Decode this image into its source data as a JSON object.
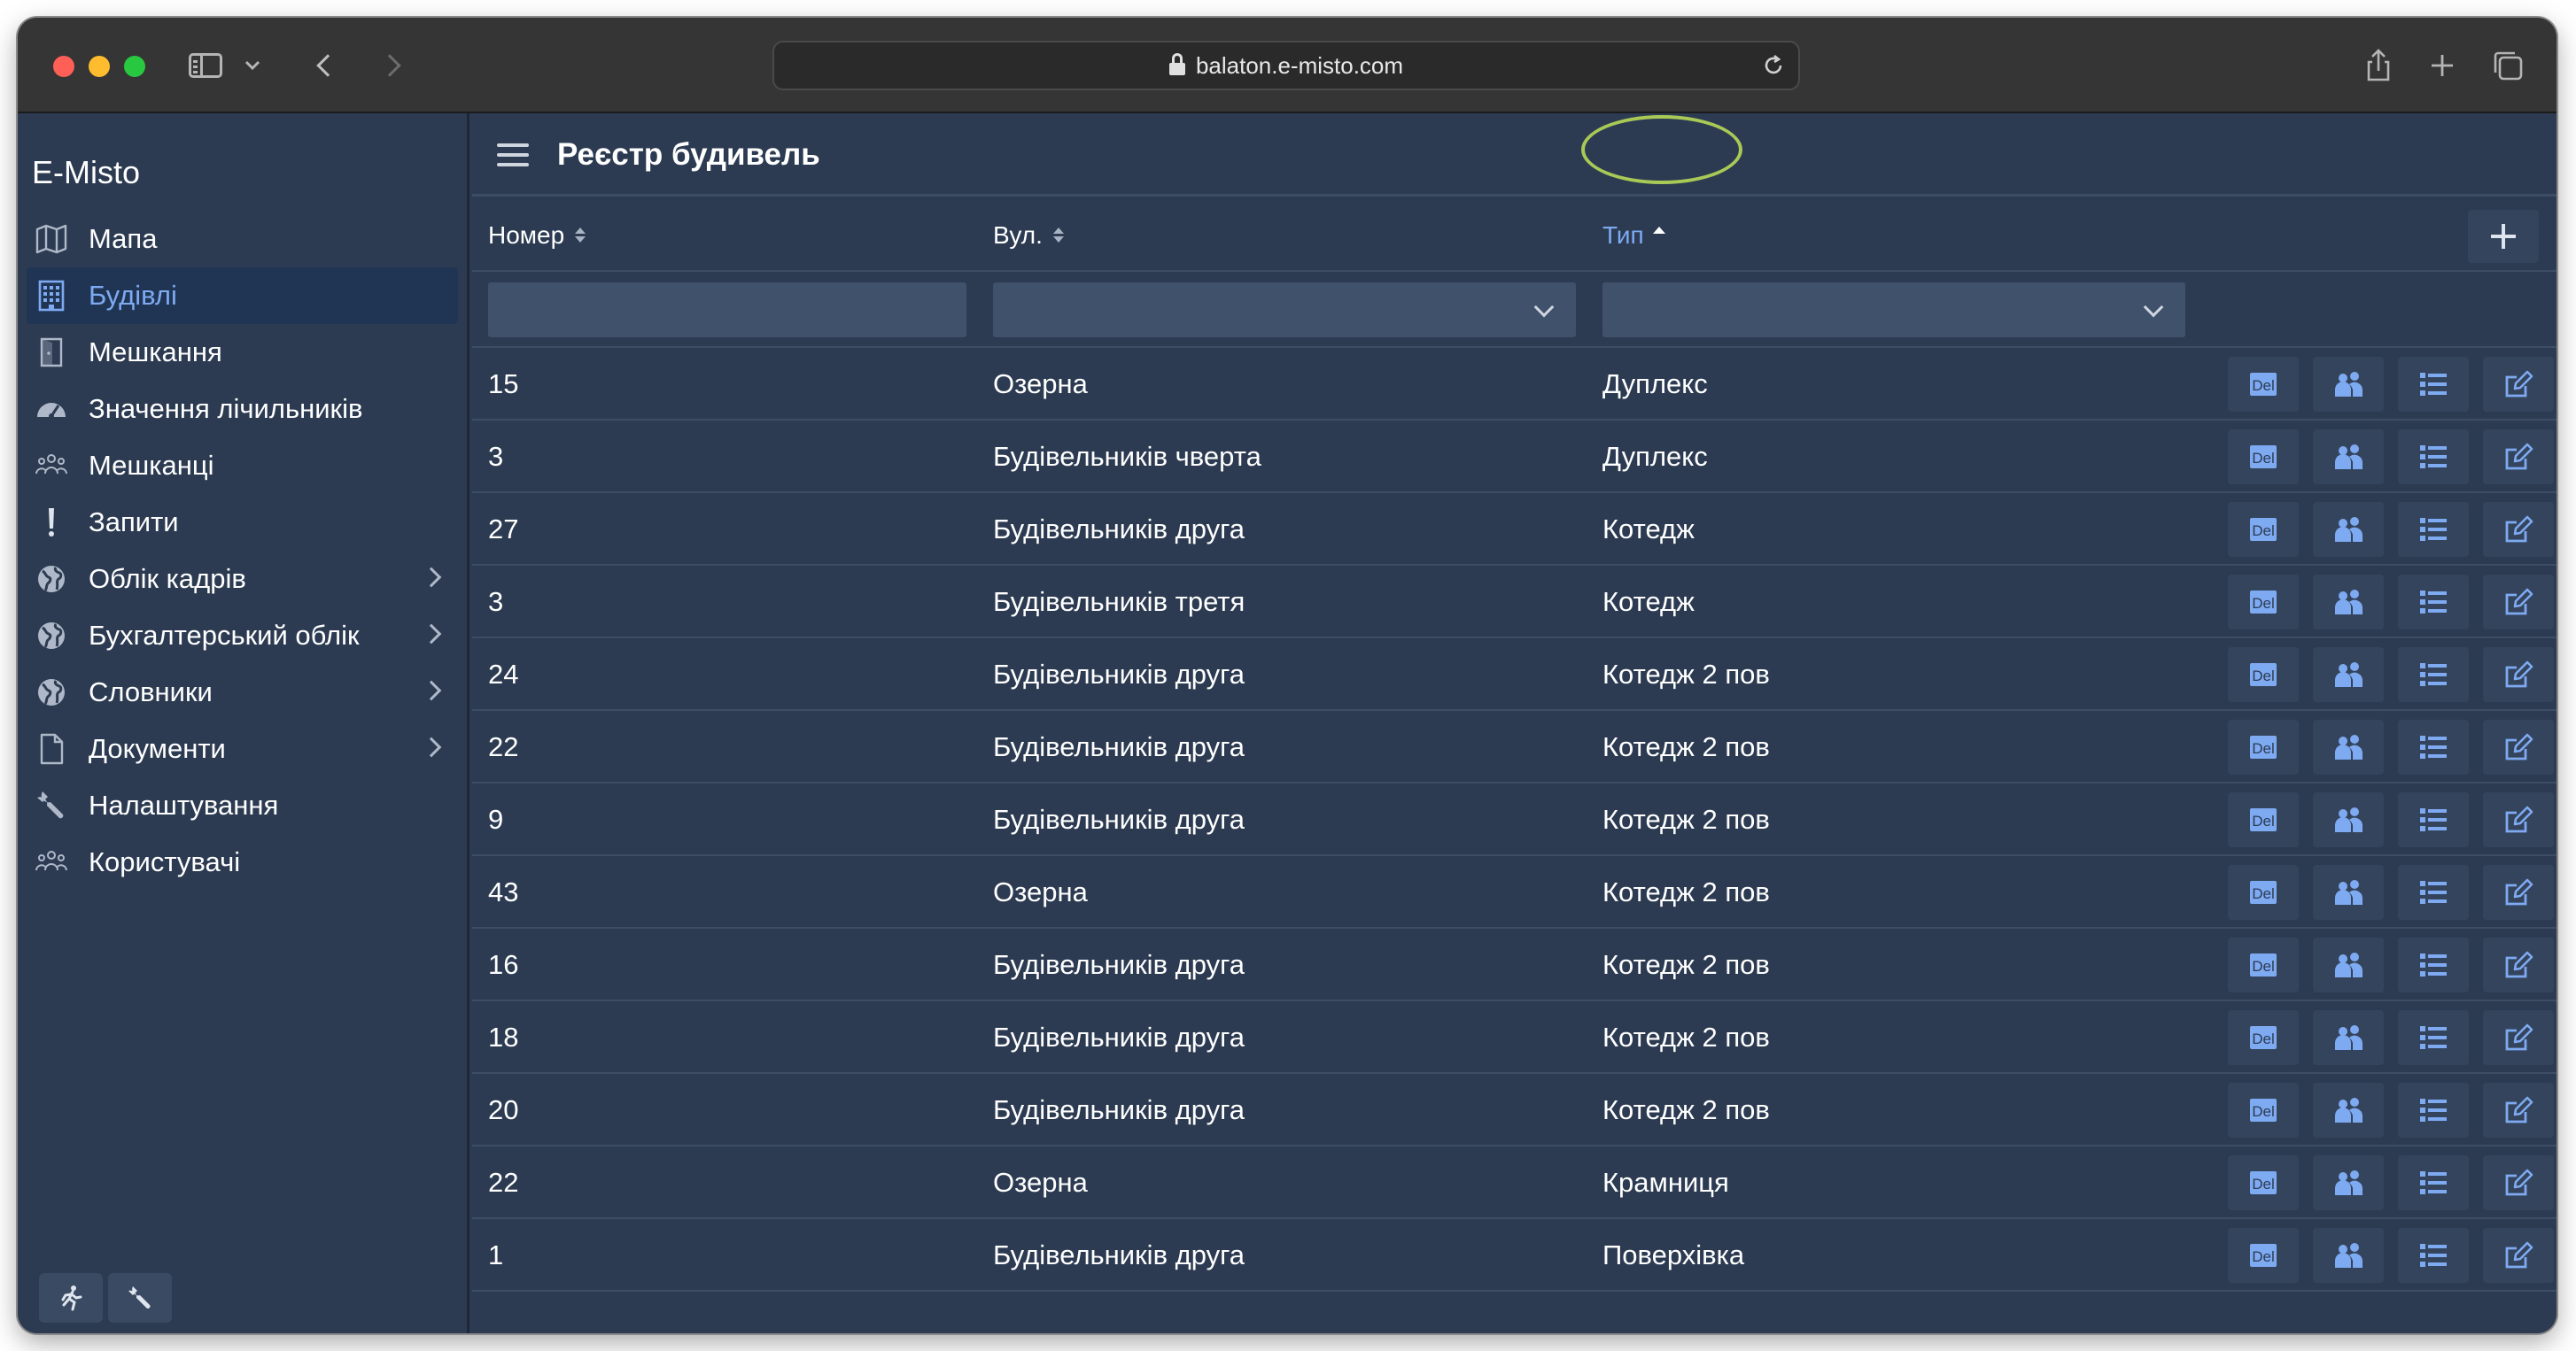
{
  "browser": {
    "url": "balaton.e-misto.com"
  },
  "app": {
    "title": "E-Misto",
    "nav": [
      {
        "label": "Мапа",
        "icon": "map-icon",
        "active": false,
        "has_children": false
      },
      {
        "label": "Будівлі",
        "icon": "building-icon",
        "active": true,
        "has_children": false
      },
      {
        "label": "Мешкання",
        "icon": "door-icon",
        "active": false,
        "has_children": false
      },
      {
        "label": "Значення лічильників",
        "icon": "gauge-icon",
        "active": false,
        "has_children": false
      },
      {
        "label": "Мешканці",
        "icon": "people-icon",
        "active": false,
        "has_children": false
      },
      {
        "label": "Запити",
        "icon": "exclamation-icon",
        "active": false,
        "has_children": false
      },
      {
        "label": "Облік кадрів",
        "icon": "globe-icon",
        "active": false,
        "has_children": true
      },
      {
        "label": "Бухгалтерський облік",
        "icon": "globe-icon",
        "active": false,
        "has_children": true
      },
      {
        "label": "Словники",
        "icon": "globe-icon",
        "active": false,
        "has_children": true
      },
      {
        "label": "Документи",
        "icon": "document-icon",
        "active": false,
        "has_children": true
      },
      {
        "label": "Налаштування",
        "icon": "wrench-icon",
        "active": false,
        "has_children": false
      },
      {
        "label": "Користувачі",
        "icon": "people-icon",
        "active": false,
        "has_children": false
      }
    ]
  },
  "page": {
    "title": "Реєстр будивель"
  },
  "table": {
    "columns": {
      "number": "Номер",
      "street": "Вул.",
      "type": "Тип"
    },
    "sorted_column": "type",
    "sort_direction": "ascending",
    "rows": [
      {
        "number": "15",
        "street": "Озерна",
        "type": "Дуплекс"
      },
      {
        "number": "3",
        "street": "Будівельників чверта",
        "type": "Дуплекс"
      },
      {
        "number": "27",
        "street": "Будівельників друга",
        "type": "Котедж"
      },
      {
        "number": "3",
        "street": "Будівельників третя",
        "type": "Котедж"
      },
      {
        "number": "24",
        "street": "Будівельників друга",
        "type": "Котедж 2 пов"
      },
      {
        "number": "22",
        "street": "Будівельників друга",
        "type": "Котедж 2 пов"
      },
      {
        "number": "9",
        "street": "Будівельників друга",
        "type": "Котедж 2 пов"
      },
      {
        "number": "43",
        "street": "Озерна",
        "type": "Котедж 2 пов"
      },
      {
        "number": "16",
        "street": "Будівельників друга",
        "type": "Котедж 2 пов"
      },
      {
        "number": "18",
        "street": "Будівельників друга",
        "type": "Котедж 2 пов"
      },
      {
        "number": "20",
        "street": "Будівельників друга",
        "type": "Котедж 2 пов"
      },
      {
        "number": "22",
        "street": "Озерна",
        "type": "Крамниця"
      },
      {
        "number": "1",
        "street": "Будівельників друга",
        "type": "Поверхівка"
      }
    ],
    "row_actions": [
      "delete-icon",
      "residents-icon",
      "list-icon",
      "edit-icon"
    ],
    "delete_label": "Del"
  },
  "colors": {
    "background": "#2c3b52",
    "accent": "#7eaaf2",
    "highlight": "#a9c956"
  }
}
